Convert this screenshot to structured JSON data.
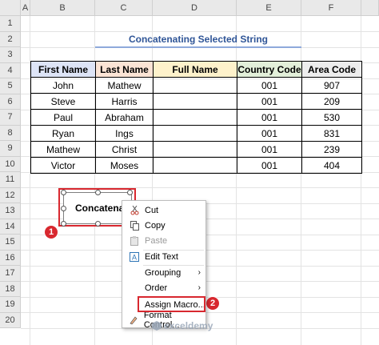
{
  "columns": [
    "A",
    "B",
    "C",
    "D",
    "E",
    "F"
  ],
  "rows": [
    "1",
    "2",
    "3",
    "4",
    "5",
    "6",
    "7",
    "8",
    "9",
    "10",
    "11",
    "12",
    "13",
    "14",
    "15",
    "16",
    "17",
    "18",
    "19",
    "20"
  ],
  "title": "Concatenating Selected String",
  "table": {
    "headers": [
      "First Name",
      "Last Name",
      "Full Name",
      "Country Code",
      "Area Code"
    ],
    "header_colors": [
      "#dde4f6",
      "#fbe4d5",
      "#fef2cb",
      "#e2efd9",
      "#ededed"
    ],
    "rows": [
      [
        "John",
        "Mathew",
        "",
        "001",
        "907"
      ],
      [
        "Steve",
        "Harris",
        "",
        "001",
        "209"
      ],
      [
        "Paul",
        "Abraham",
        "",
        "001",
        "530"
      ],
      [
        "Ryan",
        "Ings",
        "",
        "001",
        "831"
      ],
      [
        "Mathew",
        "Christ",
        "",
        "001",
        "239"
      ],
      [
        "Victor",
        "Moses",
        "",
        "001",
        "404"
      ]
    ]
  },
  "button": {
    "label": "Concatenate"
  },
  "context_menu": {
    "items": [
      {
        "label": "Cut",
        "icon": "scissors-icon",
        "disabled": false
      },
      {
        "label": "Copy",
        "icon": "copy-icon",
        "disabled": false
      },
      {
        "label": "Paste",
        "icon": "paste-icon",
        "disabled": true
      },
      {
        "label": "Edit Text",
        "icon": "edit-text-icon",
        "disabled": false
      },
      {
        "label": "Grouping",
        "icon": "",
        "disabled": false,
        "submenu": true
      },
      {
        "label": "Order",
        "icon": "",
        "disabled": false,
        "submenu": true
      },
      {
        "label": "Assign Macro...",
        "icon": "",
        "disabled": false
      },
      {
        "label": "Format Control...",
        "icon": "format-control-icon",
        "disabled": false
      }
    ]
  },
  "badges": [
    "1",
    "2"
  ],
  "accent_red": "#d8282f",
  "watermark": "exceldemy"
}
